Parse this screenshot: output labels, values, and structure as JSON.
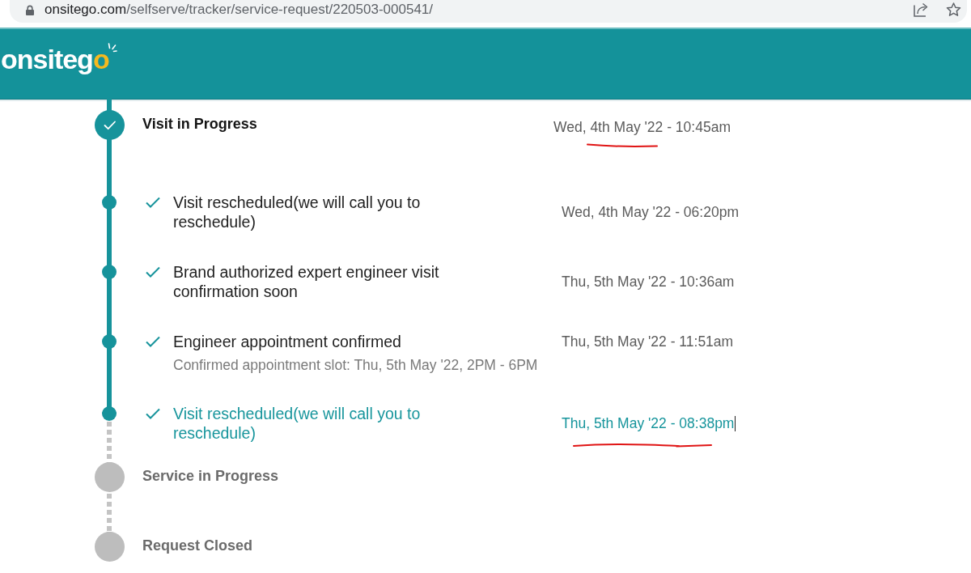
{
  "browser": {
    "url": {
      "host": "onsitego.com",
      "path": "/selfserve/tracker/service-request/220503-000541/"
    }
  },
  "header": {
    "logo": "onsitego"
  },
  "timeline": [
    {
      "title": "Visit in Progress",
      "completed": true,
      "time": "Wed, 4th May '22 - 10:45am",
      "underlined": true,
      "events": [
        {
          "title": "Visit rescheduled(we will call you to reschedule)",
          "time": "Wed, 4th May '22 - 06:20pm",
          "checked": true,
          "current": false,
          "underlined": false,
          "text_cursor": false
        },
        {
          "title": "Brand authorized expert engineer visit confirmation soon",
          "time": "Thu, 5th May '22 - 10:36am",
          "checked": true,
          "current": false,
          "underlined": false,
          "text_cursor": false
        },
        {
          "title": "Engineer appointment confirmed",
          "note": "Confirmed appointment slot: Thu, 5th May '22, 2PM - 6PM",
          "time": "Thu, 5th May '22 - 11:51am",
          "checked": true,
          "current": false,
          "underlined": false,
          "text_cursor": false
        },
        {
          "title": "Visit rescheduled(we will call you to reschedule)",
          "time": "Thu, 5th May '22 - 08:38pm",
          "checked": true,
          "current": true,
          "underlined": true,
          "text_cursor": true
        }
      ]
    },
    {
      "title": "Service in Progress",
      "completed": false
    },
    {
      "title": "Request Closed",
      "completed": false
    }
  ]
}
